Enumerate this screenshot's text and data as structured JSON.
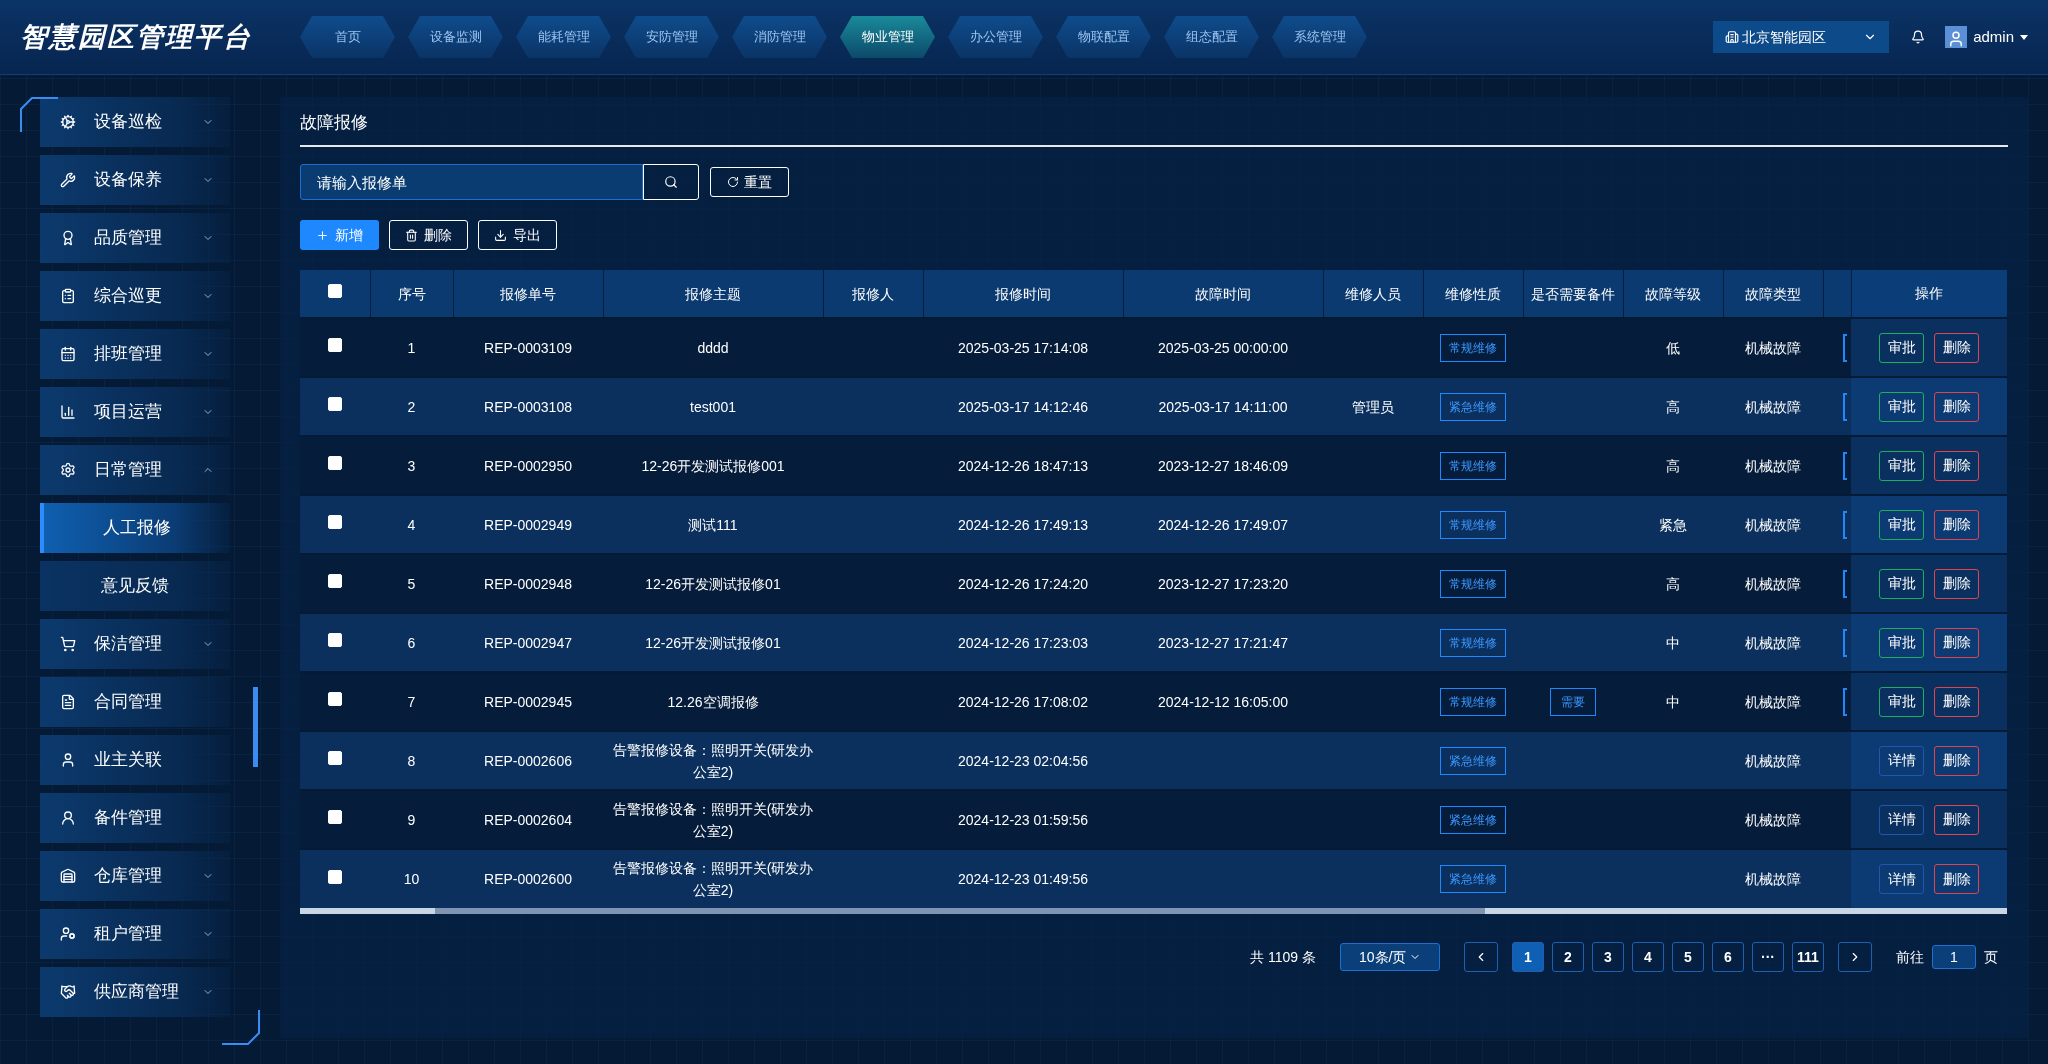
{
  "header": {
    "title": "智慧园区管理平台",
    "nav": [
      {
        "label": "首页",
        "selected": false
      },
      {
        "label": "设备监测",
        "selected": false
      },
      {
        "label": "能耗管理",
        "selected": false
      },
      {
        "label": "安防管理",
        "selected": false
      },
      {
        "label": "消防管理",
        "selected": false
      },
      {
        "label": "物业管理",
        "selected": true
      },
      {
        "label": "办公管理",
        "selected": false
      },
      {
        "label": "物联配置",
        "selected": false
      },
      {
        "label": "组态配置",
        "selected": false
      },
      {
        "label": "系统管理",
        "selected": false
      }
    ],
    "park_select": "北京智能园区",
    "user": "admin"
  },
  "sidebar": {
    "items": [
      {
        "label": "设备巡检",
        "kind": "group",
        "expanded": false
      },
      {
        "label": "设备保养",
        "kind": "group",
        "expanded": false
      },
      {
        "label": "品质管理",
        "kind": "group",
        "expanded": false
      },
      {
        "label": "综合巡更",
        "kind": "group",
        "expanded": false
      },
      {
        "label": "排班管理",
        "kind": "group",
        "expanded": false
      },
      {
        "label": "项目运营",
        "kind": "group",
        "expanded": false
      },
      {
        "label": "日常管理",
        "kind": "group",
        "expanded": true,
        "children": [
          {
            "label": "人工报修",
            "selected": true
          },
          {
            "label": "意见反馈",
            "selected": false
          }
        ]
      },
      {
        "label": "保洁管理",
        "kind": "group",
        "expanded": false
      },
      {
        "label": "合同管理",
        "kind": "link"
      },
      {
        "label": "业主关联",
        "kind": "link"
      },
      {
        "label": "备件管理",
        "kind": "link"
      },
      {
        "label": "仓库管理",
        "kind": "group",
        "expanded": false
      },
      {
        "label": "租户管理",
        "kind": "group",
        "expanded": false
      },
      {
        "label": "供应商管理",
        "kind": "group",
        "expanded": false
      }
    ]
  },
  "panel": {
    "title": "故障报修",
    "search": {
      "placeholder": "请输入报修单",
      "reset": "重置"
    },
    "toolbar": [
      {
        "label": "新增",
        "kind": "add"
      },
      {
        "label": "删除",
        "kind": "delete"
      },
      {
        "label": "导出",
        "kind": "export"
      }
    ],
    "table": {
      "select_all_checked": false,
      "columns": [
        "序号",
        "报修单号",
        "报修主题",
        "报修人",
        "报修时间",
        "故障时间",
        "维修人员",
        "维修性质",
        "是否需要备件",
        "故障等级",
        "故障类型",
        "操作"
      ],
      "rows": [
        {
          "checked": false,
          "no": "1",
          "code": "REP-0003109",
          "subject": "dddd",
          "reporter": "",
          "report_time": "2025-03-25 17:14:08",
          "fault_time": "2025-03-25 00:00:00",
          "staff": "",
          "nature": "常规维修",
          "spare": "",
          "level": "低",
          "type": "机械故障",
          "cut_tag": true,
          "actions": [
            {
              "label": "审批",
              "kind": "approve"
            },
            {
              "label": "删除",
              "kind": "delete"
            }
          ]
        },
        {
          "checked": false,
          "no": "2",
          "code": "REP-0003108",
          "subject": "test001",
          "reporter": "",
          "report_time": "2025-03-17 14:12:46",
          "fault_time": "2025-03-17 14:11:00",
          "staff": "管理员",
          "nature": "紧急维修",
          "spare": "",
          "level": "高",
          "type": "机械故障",
          "cut_tag": true,
          "actions": [
            {
              "label": "审批",
              "kind": "approve"
            },
            {
              "label": "删除",
              "kind": "delete"
            }
          ]
        },
        {
          "checked": false,
          "no": "3",
          "code": "REP-0002950",
          "subject": "12-26开发测试报修001",
          "reporter": "",
          "report_time": "2024-12-26 18:47:13",
          "fault_time": "2023-12-27 18:46:09",
          "staff": "",
          "nature": "常规维修",
          "spare": "",
          "level": "高",
          "type": "机械故障",
          "cut_tag": true,
          "actions": [
            {
              "label": "审批",
              "kind": "approve"
            },
            {
              "label": "删除",
              "kind": "delete"
            }
          ]
        },
        {
          "checked": false,
          "no": "4",
          "code": "REP-0002949",
          "subject": "测试111",
          "reporter": "",
          "report_time": "2024-12-26 17:49:13",
          "fault_time": "2024-12-26 17:49:07",
          "staff": "",
          "nature": "常规维修",
          "spare": "",
          "level": "紧急",
          "type": "机械故障",
          "cut_tag": true,
          "actions": [
            {
              "label": "审批",
              "kind": "approve"
            },
            {
              "label": "删除",
              "kind": "delete"
            }
          ]
        },
        {
          "checked": false,
          "no": "5",
          "code": "REP-0002948",
          "subject": "12-26开发测试报修01",
          "reporter": "",
          "report_time": "2024-12-26 17:24:20",
          "fault_time": "2023-12-27 17:23:20",
          "staff": "",
          "nature": "常规维修",
          "spare": "",
          "level": "高",
          "type": "机械故障",
          "cut_tag": true,
          "actions": [
            {
              "label": "审批",
              "kind": "approve"
            },
            {
              "label": "删除",
              "kind": "delete"
            }
          ]
        },
        {
          "checked": false,
          "no": "6",
          "code": "REP-0002947",
          "subject": "12-26开发测试报修01",
          "reporter": "",
          "report_time": "2024-12-26 17:23:03",
          "fault_time": "2023-12-27 17:21:47",
          "staff": "",
          "nature": "常规维修",
          "spare": "",
          "level": "中",
          "type": "机械故障",
          "cut_tag": true,
          "actions": [
            {
              "label": "审批",
              "kind": "approve"
            },
            {
              "label": "删除",
              "kind": "delete"
            }
          ]
        },
        {
          "checked": false,
          "no": "7",
          "code": "REP-0002945",
          "subject": "12.26空调报修",
          "reporter": "",
          "report_time": "2024-12-26 17:08:02",
          "fault_time": "2024-12-12 16:05:00",
          "staff": "",
          "nature": "常规维修",
          "spare": "需要",
          "level": "中",
          "type": "机械故障",
          "cut_tag": true,
          "actions": [
            {
              "label": "审批",
              "kind": "approve"
            },
            {
              "label": "删除",
              "kind": "delete"
            }
          ]
        },
        {
          "checked": false,
          "no": "8",
          "code": "REP-0002606",
          "subject": "告警报修设备：照明开关(研发办公室2)",
          "reporter": "",
          "report_time": "2024-12-23 02:04:56",
          "fault_time": "",
          "staff": "",
          "nature": "紧急维修",
          "spare": "",
          "level": "",
          "type": "机械故障",
          "cut_tag": false,
          "actions": [
            {
              "label": "详情",
              "kind": "detail"
            },
            {
              "label": "删除",
              "kind": "delete"
            }
          ]
        },
        {
          "checked": false,
          "no": "9",
          "code": "REP-0002604",
          "subject": "告警报修设备：照明开关(研发办公室2)",
          "reporter": "",
          "report_time": "2024-12-23 01:59:56",
          "fault_time": "",
          "staff": "",
          "nature": "紧急维修",
          "spare": "",
          "level": "",
          "type": "机械故障",
          "cut_tag": false,
          "actions": [
            {
              "label": "详情",
              "kind": "detail"
            },
            {
              "label": "删除",
              "kind": "delete"
            }
          ]
        },
        {
          "checked": false,
          "no": "10",
          "code": "REP-0002600",
          "subject": "告警报修设备：照明开关(研发办公室2)",
          "reporter": "",
          "report_time": "2024-12-23 01:49:56",
          "fault_time": "",
          "staff": "",
          "nature": "紧急维修",
          "spare": "",
          "level": "",
          "type": "机械故障",
          "cut_tag": false,
          "actions": [
            {
              "label": "详情",
              "kind": "detail"
            },
            {
              "label": "删除",
              "kind": "delete"
            }
          ]
        }
      ]
    },
    "pagination": {
      "total": "共 1109 条",
      "page_size": "10条/页",
      "pages": [
        {
          "label": "1",
          "selected": true
        },
        {
          "label": "2",
          "selected": false
        },
        {
          "label": "3",
          "selected": false
        },
        {
          "label": "4",
          "selected": false
        },
        {
          "label": "5",
          "selected": false
        },
        {
          "label": "6",
          "selected": false
        },
        {
          "label": "···",
          "selected": false
        },
        {
          "label": "111",
          "selected": false
        }
      ],
      "goto_label": "前往",
      "goto_value": "1",
      "goto_suffix": "页"
    }
  }
}
